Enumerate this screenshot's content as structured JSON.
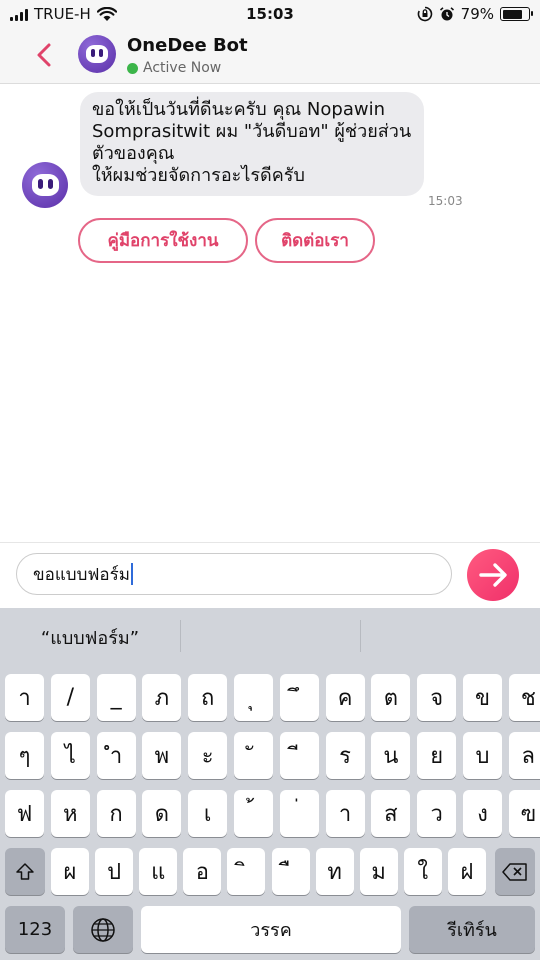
{
  "status_bar": {
    "carrier": "TRUE-H",
    "time": "15:03",
    "battery": "79%",
    "battery_level": 0.79
  },
  "header": {
    "bot_name": "OneDee Bot",
    "status": "Active Now",
    "status_color": "#3cb54a",
    "back_icon": "chevron-left-icon"
  },
  "chat": {
    "message": "ขอให้เป็นวันที่ดีนะครับ คุณ Nopawin Somprasitwit ผม \"วันดีบอท\" ผู้ช่วยส่วนตัวของคุณ\nให้ผมช่วยจัดการอะไรดีครับ",
    "time": "15:03",
    "quick_replies": [
      "คู่มือการใช้งาน",
      "ติดต่อเรา"
    ]
  },
  "composer": {
    "input_value": "ขอแบบฟอร์ม",
    "send_icon": "arrow-right-icon",
    "accent": "#f0306a"
  },
  "keyboard": {
    "suggestions": [
      "“แบบฟอร์ม”",
      "",
      ""
    ],
    "row1": [
      "า",
      "/",
      "_",
      "ภ",
      "ถ",
      "ุ",
      "ึ",
      "ค",
      "ต",
      "จ",
      "ข",
      "ช"
    ],
    "row2": [
      "ๆ",
      "ไ",
      "ำ",
      "พ",
      "ะ",
      "ั",
      "ี",
      "ร",
      "น",
      "ย",
      "บ",
      "ล"
    ],
    "row3": [
      "ฟ",
      "ห",
      "ก",
      "ด",
      "เ",
      "้",
      "่",
      "า",
      "ส",
      "ว",
      "ง",
      "ฃ"
    ],
    "row4": [
      "ผ",
      "ป",
      "แ",
      "อ",
      "ิ",
      "ื",
      "ท",
      "ม",
      "ใ",
      "ฝ"
    ],
    "numbers": "123",
    "space": "วรรค",
    "return": "รีเทิร์น"
  }
}
